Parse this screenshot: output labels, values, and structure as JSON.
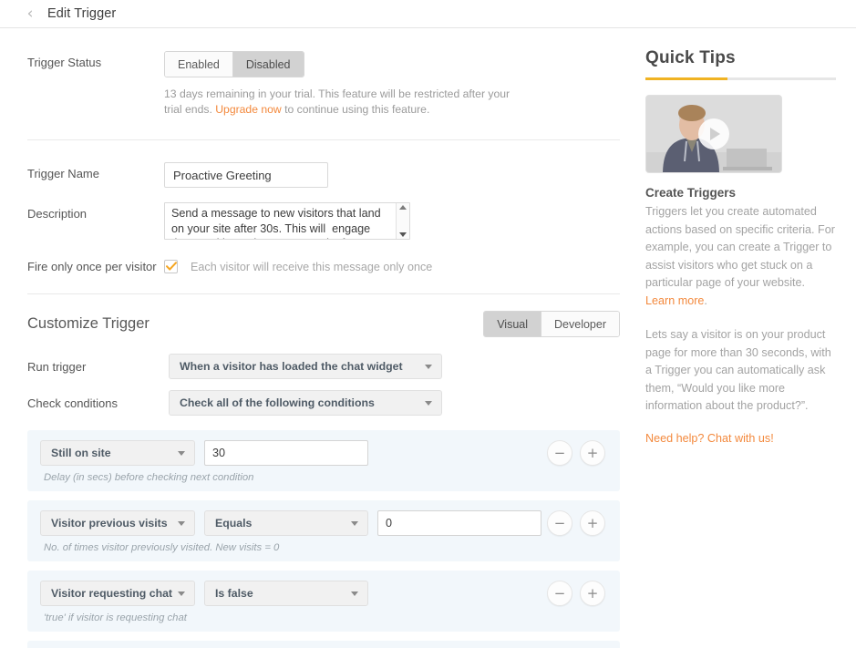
{
  "header": {
    "back_icon": "chevron-left-icon",
    "title": "Edit Trigger"
  },
  "form": {
    "status": {
      "label": "Trigger Status",
      "options": [
        "Enabled",
        "Disabled"
      ],
      "selected": "Disabled",
      "trial_note_part1": "13 days remaining in your trial. This feature will be restricted after your trial ends. ",
      "trial_note_link": "Upgrade now",
      "trial_note_part2": " to continue using this feature."
    },
    "trigger_name": {
      "label": "Trigger Name",
      "value": "Proactive Greeting",
      "placeholder": "Trigger Name"
    },
    "description": {
      "label": "Description",
      "value": "Send a message to new visitors that land on your site after 30s. This will  engage them and keep them on your site for longer."
    },
    "fire_once": {
      "label": "Fire only once per visitor",
      "checked": true,
      "note": "Each visitor will receive this message only once"
    }
  },
  "customize": {
    "title": "Customize Trigger",
    "mode_tabs": [
      "Visual",
      "Developer"
    ],
    "mode_selected": "Visual",
    "run_trigger": {
      "label": "Run trigger",
      "value": "When a visitor has loaded the chat widget"
    },
    "check_conditions": {
      "label": "Check conditions",
      "value": "Check all of the following conditions"
    },
    "conditions": [
      {
        "field": "Still on site",
        "operator": null,
        "value": "30",
        "hint": "Delay (in secs) before checking next condition",
        "remove_label": "−",
        "add_label": "+"
      },
      {
        "field": "Visitor previous visits",
        "operator": "Equals",
        "value": "0",
        "hint": "No. of times visitor previously visited. New visits = 0",
        "remove_label": "−",
        "add_label": "+"
      },
      {
        "field": "Visitor requesting chat",
        "operator": "Is false",
        "value": null,
        "hint": "'true' if visitor is requesting chat",
        "remove_label": "−",
        "add_label": "+"
      }
    ]
  },
  "quick_tips": {
    "title": "Quick Tips",
    "video_icon": "play-button-icon",
    "tip_title": "Create Triggers",
    "paragraph1_part1": "Triggers let you create automated actions based on specific criteria. For example, you can create a Trigger to assist visitors who get stuck on a particular page of your website. ",
    "paragraph1_link": "Learn more",
    "paragraph1_part2": ".",
    "paragraph2": "Lets say a visitor is on your product page for more than 30 seconds, with a Trigger you can automatically ask them, “Would you like more information about the product?”.",
    "chat_link": "Need help? Chat with us!"
  },
  "colors": {
    "accent_orange": "#f3893d",
    "tip_underline": "#f0b323",
    "condition_bg": "#f2f7fb"
  }
}
